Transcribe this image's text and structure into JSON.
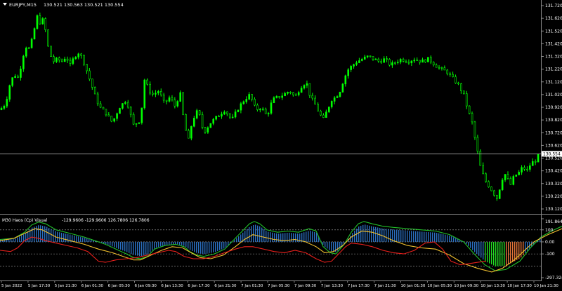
{
  "chart_data": [
    {
      "type": "candlestick",
      "title": "EURJPY,M15  130.521 130.563 130.521 130.554",
      "symbol_label": "EURJPY,M15",
      "ohlc_label": "130.521 130.563 130.521 130.554",
      "ylim": [
        130.12,
        131.72
      ],
      "y_ticks": [
        131.72,
        131.62,
        131.52,
        131.42,
        131.32,
        131.22,
        131.12,
        131.02,
        130.92,
        130.82,
        130.72,
        130.62,
        130.52,
        130.42,
        130.32,
        130.22,
        130.12
      ],
      "y_tick_labels": [
        "131.720",
        "131.620",
        "131.520",
        "131.420",
        "131.320",
        "131.220",
        "131.120",
        "131.020",
        "130.920",
        "130.820",
        "130.720",
        "130.620",
        "130.520",
        "130.420",
        "130.320",
        "130.220",
        "130.120"
      ],
      "current_price": 130.554,
      "current_price_label": "130.554",
      "bars": 196,
      "price_path": [
        [
          0,
          130.9
        ],
        [
          8,
          130.95
        ],
        [
          14,
          131.1
        ],
        [
          20,
          131.18
        ],
        [
          26,
          131.15
        ],
        [
          30,
          131.25
        ],
        [
          36,
          131.4
        ],
        [
          42,
          131.38
        ],
        [
          48,
          131.5
        ],
        [
          52,
          131.65
        ],
        [
          56,
          131.58
        ],
        [
          60,
          131.62
        ],
        [
          64,
          131.55
        ],
        [
          70,
          131.35
        ],
        [
          76,
          131.28
        ],
        [
          82,
          131.3
        ],
        [
          88,
          131.28
        ],
        [
          94,
          131.32
        ],
        [
          100,
          131.25
        ],
        [
          106,
          131.32
        ],
        [
          112,
          131.35
        ],
        [
          118,
          131.3
        ],
        [
          124,
          131.2
        ],
        [
          130,
          131.1
        ],
        [
          136,
          131.0
        ],
        [
          142,
          130.92
        ],
        [
          150,
          130.88
        ],
        [
          160,
          130.8
        ],
        [
          170,
          130.92
        ],
        [
          180,
          130.98
        ],
        [
          190,
          130.78
        ],
        [
          200,
          130.82
        ],
        [
          206,
          131.15
        ],
        [
          212,
          131.05
        ],
        [
          218,
          131.02
        ],
        [
          226,
          131.05
        ],
        [
          234,
          130.95
        ],
        [
          242,
          131.0
        ],
        [
          250,
          130.92
        ],
        [
          256,
          131.05
        ],
        [
          262,
          130.8
        ],
        [
          268,
          130.65
        ],
        [
          274,
          130.82
        ],
        [
          282,
          130.9
        ],
        [
          290,
          130.72
        ],
        [
          300,
          130.8
        ],
        [
          310,
          130.85
        ],
        [
          320,
          130.9
        ],
        [
          330,
          130.82
        ],
        [
          340,
          130.92
        ],
        [
          348,
          130.98
        ],
        [
          356,
          131.02
        ],
        [
          364,
          130.9
        ],
        [
          372,
          130.92
        ],
        [
          380,
          130.85
        ],
        [
          388,
          130.98
        ],
        [
          396,
          131.0
        ],
        [
          404,
          131.02
        ],
        [
          412,
          131.05
        ],
        [
          420,
          131.0
        ],
        [
          428,
          131.08
        ],
        [
          436,
          131.12
        ],
        [
          442,
          131.0
        ],
        [
          448,
          130.95
        ],
        [
          454,
          130.88
        ],
        [
          460,
          130.82
        ],
        [
          466,
          130.9
        ],
        [
          472,
          130.98
        ],
        [
          478,
          131.0
        ],
        [
          484,
          131.05
        ],
        [
          490,
          131.15
        ],
        [
          496,
          131.22
        ],
        [
          502,
          131.25
        ],
        [
          508,
          131.28
        ],
        [
          516,
          131.3
        ],
        [
          524,
          131.32
        ],
        [
          532,
          131.3
        ],
        [
          540,
          131.28
        ],
        [
          548,
          131.3
        ],
        [
          556,
          131.25
        ],
        [
          564,
          131.28
        ],
        [
          572,
          131.3
        ],
        [
          580,
          131.28
        ],
        [
          590,
          131.3
        ],
        [
          600,
          131.28
        ],
        [
          610,
          131.3
        ],
        [
          620,
          131.25
        ],
        [
          628,
          131.22
        ],
        [
          636,
          131.2
        ],
        [
          644,
          131.15
        ],
        [
          652,
          131.1
        ],
        [
          660,
          131.02
        ],
        [
          666,
          130.9
        ],
        [
          672,
          130.8
        ],
        [
          678,
          130.62
        ],
        [
          684,
          130.45
        ],
        [
          690,
          130.35
        ],
        [
          696,
          130.3
        ],
        [
          702,
          130.25
        ],
        [
          708,
          130.2
        ],
        [
          714,
          130.35
        ],
        [
          720,
          130.4
        ],
        [
          726,
          130.3
        ],
        [
          732,
          130.38
        ],
        [
          738,
          130.4
        ],
        [
          744,
          130.45
        ],
        [
          750,
          130.42
        ],
        [
          756,
          130.48
        ],
        [
          762,
          130.5
        ],
        [
          768,
          130.55
        ]
      ]
    },
    {
      "type": "indicator",
      "title": "M30 Haos (Cp) Visual -129.9606 -129.9606 126.7806 126.7806",
      "label": "M30 Haos (Cp) Visual",
      "values_label": "-129.9606 -129.9606 126.7806 126.7806",
      "ylim": [
        -297.3242,
        191.8645
      ],
      "y_tick_labels": [
        "191.8645",
        "100",
        "0.00",
        "-100",
        "-297.3242"
      ],
      "y_ticks": [
        191.8645,
        100,
        0,
        -100,
        -297.3242
      ],
      "guide_levels": [
        100,
        0,
        -100,
        -200
      ],
      "series": [
        {
          "name": "Green line",
          "color": "#22c02a",
          "points": [
            [
              0,
              20
            ],
            [
              20,
              30
            ],
            [
              35,
              80
            ],
            [
              45,
              140
            ],
            [
              55,
              165
            ],
            [
              65,
              150
            ],
            [
              80,
              100
            ],
            [
              100,
              70
            ],
            [
              120,
              40
            ],
            [
              135,
              10
            ],
            [
              150,
              -20
            ],
            [
              165,
              -60
            ],
            [
              180,
              -100
            ],
            [
              190,
              -130
            ],
            [
              200,
              -140
            ],
            [
              210,
              -120
            ],
            [
              220,
              -60
            ],
            [
              235,
              -30
            ],
            [
              250,
              -20
            ],
            [
              262,
              -40
            ],
            [
              270,
              -80
            ],
            [
              280,
              -110
            ],
            [
              290,
              -120
            ],
            [
              305,
              -100
            ],
            [
              320,
              -60
            ],
            [
              335,
              30
            ],
            [
              345,
              90
            ],
            [
              355,
              150
            ],
            [
              362,
              170
            ],
            [
              370,
              150
            ],
            [
              380,
              100
            ],
            [
              395,
              80
            ],
            [
              410,
              90
            ],
            [
              425,
              80
            ],
            [
              440,
              110
            ],
            [
              450,
              90
            ],
            [
              460,
              -40
            ],
            [
              470,
              -90
            ],
            [
              478,
              -100
            ],
            [
              490,
              -20
            ],
            [
              500,
              80
            ],
            [
              510,
              150
            ],
            [
              518,
              170
            ],
            [
              530,
              150
            ],
            [
              545,
              130
            ],
            [
              560,
              120
            ],
            [
              580,
              110
            ],
            [
              600,
              100
            ],
            [
              620,
              90
            ],
            [
              640,
              60
            ],
            [
              660,
              0
            ],
            [
              675,
              -100
            ],
            [
              690,
              -190
            ],
            [
              705,
              -240
            ],
            [
              720,
              -230
            ],
            [
              740,
              -160
            ],
            [
              755,
              -50
            ],
            [
              770,
              40
            ],
            [
              785,
              90
            ],
            [
              800,
              130
            ]
          ]
        },
        {
          "name": "Yellow line",
          "color": "#f2c12e",
          "points": [
            [
              0,
              10
            ],
            [
              20,
              30
            ],
            [
              35,
              70
            ],
            [
              50,
              110
            ],
            [
              60,
              100
            ],
            [
              70,
              70
            ],
            [
              80,
              40
            ],
            [
              100,
              10
            ],
            [
              120,
              -20
            ],
            [
              140,
              -60
            ],
            [
              160,
              -90
            ],
            [
              175,
              -120
            ],
            [
              190,
              -150
            ],
            [
              200,
              -150
            ],
            [
              215,
              -110
            ],
            [
              230,
              -70
            ],
            [
              245,
              -40
            ],
            [
              260,
              -50
            ],
            [
              272,
              -90
            ],
            [
              285,
              -130
            ],
            [
              300,
              -140
            ],
            [
              318,
              -110
            ],
            [
              335,
              -40
            ],
            [
              348,
              20
            ],
            [
              360,
              60
            ],
            [
              375,
              40
            ],
            [
              390,
              20
            ],
            [
              405,
              10
            ],
            [
              420,
              20
            ],
            [
              435,
              0
            ],
            [
              450,
              -40
            ],
            [
              462,
              -90
            ],
            [
              475,
              -80
            ],
            [
              488,
              -30
            ],
            [
              500,
              40
            ],
            [
              515,
              90
            ],
            [
              530,
              80
            ],
            [
              545,
              50
            ],
            [
              560,
              10
            ],
            [
              580,
              -30
            ],
            [
              600,
              -50
            ],
            [
              620,
              -60
            ],
            [
              640,
              -110
            ],
            [
              660,
              -180
            ],
            [
              680,
              -220
            ],
            [
              700,
              -250
            ],
            [
              715,
              -220
            ],
            [
              730,
              -160
            ],
            [
              745,
              -80
            ],
            [
              760,
              0
            ],
            [
              780,
              60
            ],
            [
              800,
              110
            ]
          ]
        },
        {
          "name": "Red line",
          "color": "#e8201c",
          "points": [
            [
              0,
              -70
            ],
            [
              15,
              -80
            ],
            [
              25,
              -50
            ],
            [
              35,
              10
            ],
            [
              45,
              40
            ],
            [
              55,
              30
            ],
            [
              65,
              10
            ],
            [
              80,
              -10
            ],
            [
              95,
              -30
            ],
            [
              110,
              -50
            ],
            [
              125,
              -80
            ],
            [
              140,
              -160
            ],
            [
              150,
              -170
            ],
            [
              165,
              -150
            ],
            [
              180,
              -140
            ],
            [
              195,
              -130
            ],
            [
              210,
              -110
            ],
            [
              225,
              -90
            ],
            [
              240,
              -70
            ],
            [
              250,
              -80
            ],
            [
              262,
              -120
            ],
            [
              275,
              -140
            ],
            [
              290,
              -140
            ],
            [
              305,
              -120
            ],
            [
              320,
              -90
            ],
            [
              335,
              -60
            ],
            [
              348,
              -40
            ],
            [
              360,
              -40
            ],
            [
              375,
              -60
            ],
            [
              390,
              -80
            ],
            [
              405,
              -90
            ],
            [
              420,
              -70
            ],
            [
              435,
              -90
            ],
            [
              450,
              -140
            ],
            [
              462,
              -170
            ],
            [
              472,
              -160
            ],
            [
              482,
              -100
            ],
            [
              492,
              -40
            ],
            [
              500,
              -10
            ],
            [
              515,
              -20
            ],
            [
              530,
              -40
            ],
            [
              545,
              -70
            ],
            [
              560,
              -90
            ],
            [
              575,
              -100
            ],
            [
              590,
              -70
            ],
            [
              605,
              -10
            ],
            [
              618,
              0
            ],
            [
              630,
              -60
            ],
            [
              642,
              -160
            ],
            [
              655,
              -190
            ],
            [
              668,
              -180
            ],
            [
              680,
              -170
            ],
            [
              692,
              -160
            ]
          ]
        }
      ]
    }
  ],
  "x_axis": {
    "tick_labels": [
      "5 Jan 2022",
      "5 Jan 17:30",
      "5 Jan 21:30",
      "6 Jan 01:30",
      "6 Jan 05:30",
      "6 Jan 09:30",
      "6 Jan 13:30",
      "6 Jan 17:30",
      "6 Jan 21:30",
      "7 Jan 01:30",
      "7 Jan 05:30",
      "7 Jan 09:30",
      "7 Jan 13:30",
      "7 Jan 17:30",
      "7 Jan 21:30",
      "10 Jan 01:30",
      "10 Jan 05:30",
      "10 Jan 09:30",
      "10 Jan 13:30",
      "10 Jan 17:30",
      "10 Jan 21:30"
    ]
  },
  "colors": {
    "background": "#000000",
    "bull_candle": "#00ff00",
    "axis_text": "#ffffff",
    "grid": "#aaaaaa",
    "current_price_line": "#c0c0c0",
    "histogram_blue": "#2b6fbf",
    "histogram_green": "#22dd22",
    "histogram_orange": "#e6763a"
  }
}
